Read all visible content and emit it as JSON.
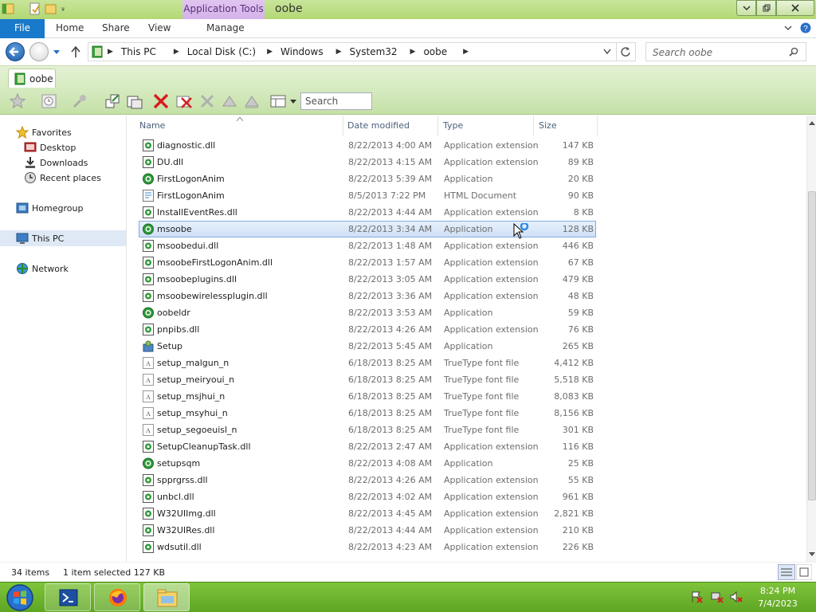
{
  "window": {
    "title": "oobe",
    "context_tab": "Application Tools"
  },
  "ribbon": {
    "tabs": [
      "File",
      "Home",
      "Share",
      "View",
      "Manage"
    ]
  },
  "address": {
    "crumbs": [
      "This PC",
      "Local Disk (C:)",
      "Windows",
      "System32",
      "oobe"
    ],
    "search_placeholder": "Search oobe"
  },
  "folder_tab": {
    "label": "oobe"
  },
  "toolbar": {
    "search_placeholder": "Search"
  },
  "navpane": {
    "favorites": "Favorites",
    "desktop": "Desktop",
    "downloads": "Downloads",
    "recent": "Recent places",
    "homegroup": "Homegroup",
    "thispc": "This PC",
    "network": "Network"
  },
  "columns": {
    "name": "Name",
    "date": "Date modified",
    "type": "Type",
    "size": "Size"
  },
  "files": [
    {
      "name": "diagnostic.dll",
      "date": "8/22/2013 4:00 AM",
      "type": "Application extension",
      "size": "147 KB",
      "icon": "dll"
    },
    {
      "name": "DU.dll",
      "date": "8/22/2013 4:15 AM",
      "type": "Application extension",
      "size": "89 KB",
      "icon": "dll"
    },
    {
      "name": "FirstLogonAnim",
      "date": "8/22/2013 5:39 AM",
      "type": "Application",
      "size": "20 KB",
      "icon": "exe"
    },
    {
      "name": "FirstLogonAnim",
      "date": "8/5/2013 7:22 PM",
      "type": "HTML Document",
      "size": "90 KB",
      "icon": "html"
    },
    {
      "name": "InstallEventRes.dll",
      "date": "8/22/2013 4:44 AM",
      "type": "Application extension",
      "size": "8 KB",
      "icon": "dll"
    },
    {
      "name": "msoobe",
      "date": "8/22/2013 3:34 AM",
      "type": "Application",
      "size": "128 KB",
      "icon": "exe"
    },
    {
      "name": "msoobedui.dll",
      "date": "8/22/2013 1:48 AM",
      "type": "Application extension",
      "size": "446 KB",
      "icon": "dll"
    },
    {
      "name": "msoobeFirstLogonAnim.dll",
      "date": "8/22/2013 1:57 AM",
      "type": "Application extension",
      "size": "67 KB",
      "icon": "dll"
    },
    {
      "name": "msoobeplugins.dll",
      "date": "8/22/2013 3:05 AM",
      "type": "Application extension",
      "size": "479 KB",
      "icon": "dll"
    },
    {
      "name": "msoobewirelessplugin.dll",
      "date": "8/22/2013 3:36 AM",
      "type": "Application extension",
      "size": "48 KB",
      "icon": "dll"
    },
    {
      "name": "oobeldr",
      "date": "8/22/2013 3:53 AM",
      "type": "Application",
      "size": "59 KB",
      "icon": "exe"
    },
    {
      "name": "pnpibs.dll",
      "date": "8/22/2013 4:26 AM",
      "type": "Application extension",
      "size": "76 KB",
      "icon": "dll"
    },
    {
      "name": "Setup",
      "date": "8/22/2013 5:45 AM",
      "type": "Application",
      "size": "265 KB",
      "icon": "setup"
    },
    {
      "name": "setup_malgun_n",
      "date": "6/18/2013 8:25 AM",
      "type": "TrueType font file",
      "size": "4,412 KB",
      "icon": "font"
    },
    {
      "name": "setup_meiryoui_n",
      "date": "6/18/2013 8:25 AM",
      "type": "TrueType font file",
      "size": "5,518 KB",
      "icon": "font"
    },
    {
      "name": "setup_msjhui_n",
      "date": "6/18/2013 8:25 AM",
      "type": "TrueType font file",
      "size": "8,083 KB",
      "icon": "font"
    },
    {
      "name": "setup_msyhui_n",
      "date": "6/18/2013 8:25 AM",
      "type": "TrueType font file",
      "size": "8,156 KB",
      "icon": "font"
    },
    {
      "name": "setup_segoeuisl_n",
      "date": "6/18/2013 8:25 AM",
      "type": "TrueType font file",
      "size": "301 KB",
      "icon": "font"
    },
    {
      "name": "SetupCleanupTask.dll",
      "date": "8/22/2013 2:47 AM",
      "type": "Application extension",
      "size": "116 KB",
      "icon": "dll"
    },
    {
      "name": "setupsqm",
      "date": "8/22/2013 4:08 AM",
      "type": "Application",
      "size": "25 KB",
      "icon": "exe"
    },
    {
      "name": "spprgrss.dll",
      "date": "8/22/2013 4:26 AM",
      "type": "Application extension",
      "size": "55 KB",
      "icon": "dll"
    },
    {
      "name": "unbcl.dll",
      "date": "8/22/2013 4:02 AM",
      "type": "Application extension",
      "size": "961 KB",
      "icon": "dll"
    },
    {
      "name": "W32UIImg.dll",
      "date": "8/22/2013 4:45 AM",
      "type": "Application extension",
      "size": "2,821 KB",
      "icon": "dll"
    },
    {
      "name": "W32UIRes.dll",
      "date": "8/22/2013 4:44 AM",
      "type": "Application extension",
      "size": "210 KB",
      "icon": "dll"
    },
    {
      "name": "wdsutil.dll",
      "date": "8/22/2013 4:23 AM",
      "type": "Application extension",
      "size": "226 KB",
      "icon": "dll"
    }
  ],
  "selected_file": "msoobe",
  "status": {
    "count": "34 items",
    "selection": "1 item selected  127 KB"
  },
  "clock": {
    "time": "8:24 PM",
    "date": "7/4/2023"
  },
  "colors": {
    "accent": "#1979ca",
    "theme": "#b3d873",
    "context": "#d4b2ea",
    "taskbar": "#6bb52a"
  }
}
